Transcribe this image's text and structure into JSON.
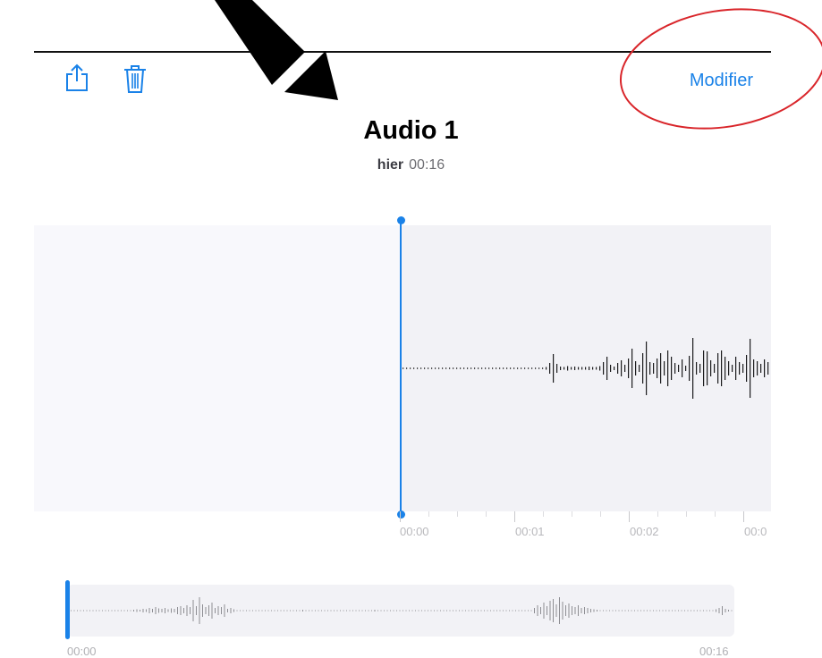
{
  "toolbar": {
    "share_icon": "share-icon",
    "trash_icon": "trash-icon",
    "edit_label": "Modifier"
  },
  "recording": {
    "title": "Audio 1",
    "date": "hier",
    "duration": "00:16"
  },
  "waveform": {
    "playhead_seconds": 0,
    "ruler_labels": [
      "00:00",
      "00:01",
      "00:02",
      "00:0"
    ]
  },
  "mini_timeline": {
    "start": "00:00",
    "end": "00:16",
    "position_seconds": 0
  },
  "colors": {
    "accent": "#1a82e8",
    "annotation_circle": "#d9252a",
    "annotation_arrow": "#000000",
    "waveform_bg": "#f2f2f6"
  }
}
